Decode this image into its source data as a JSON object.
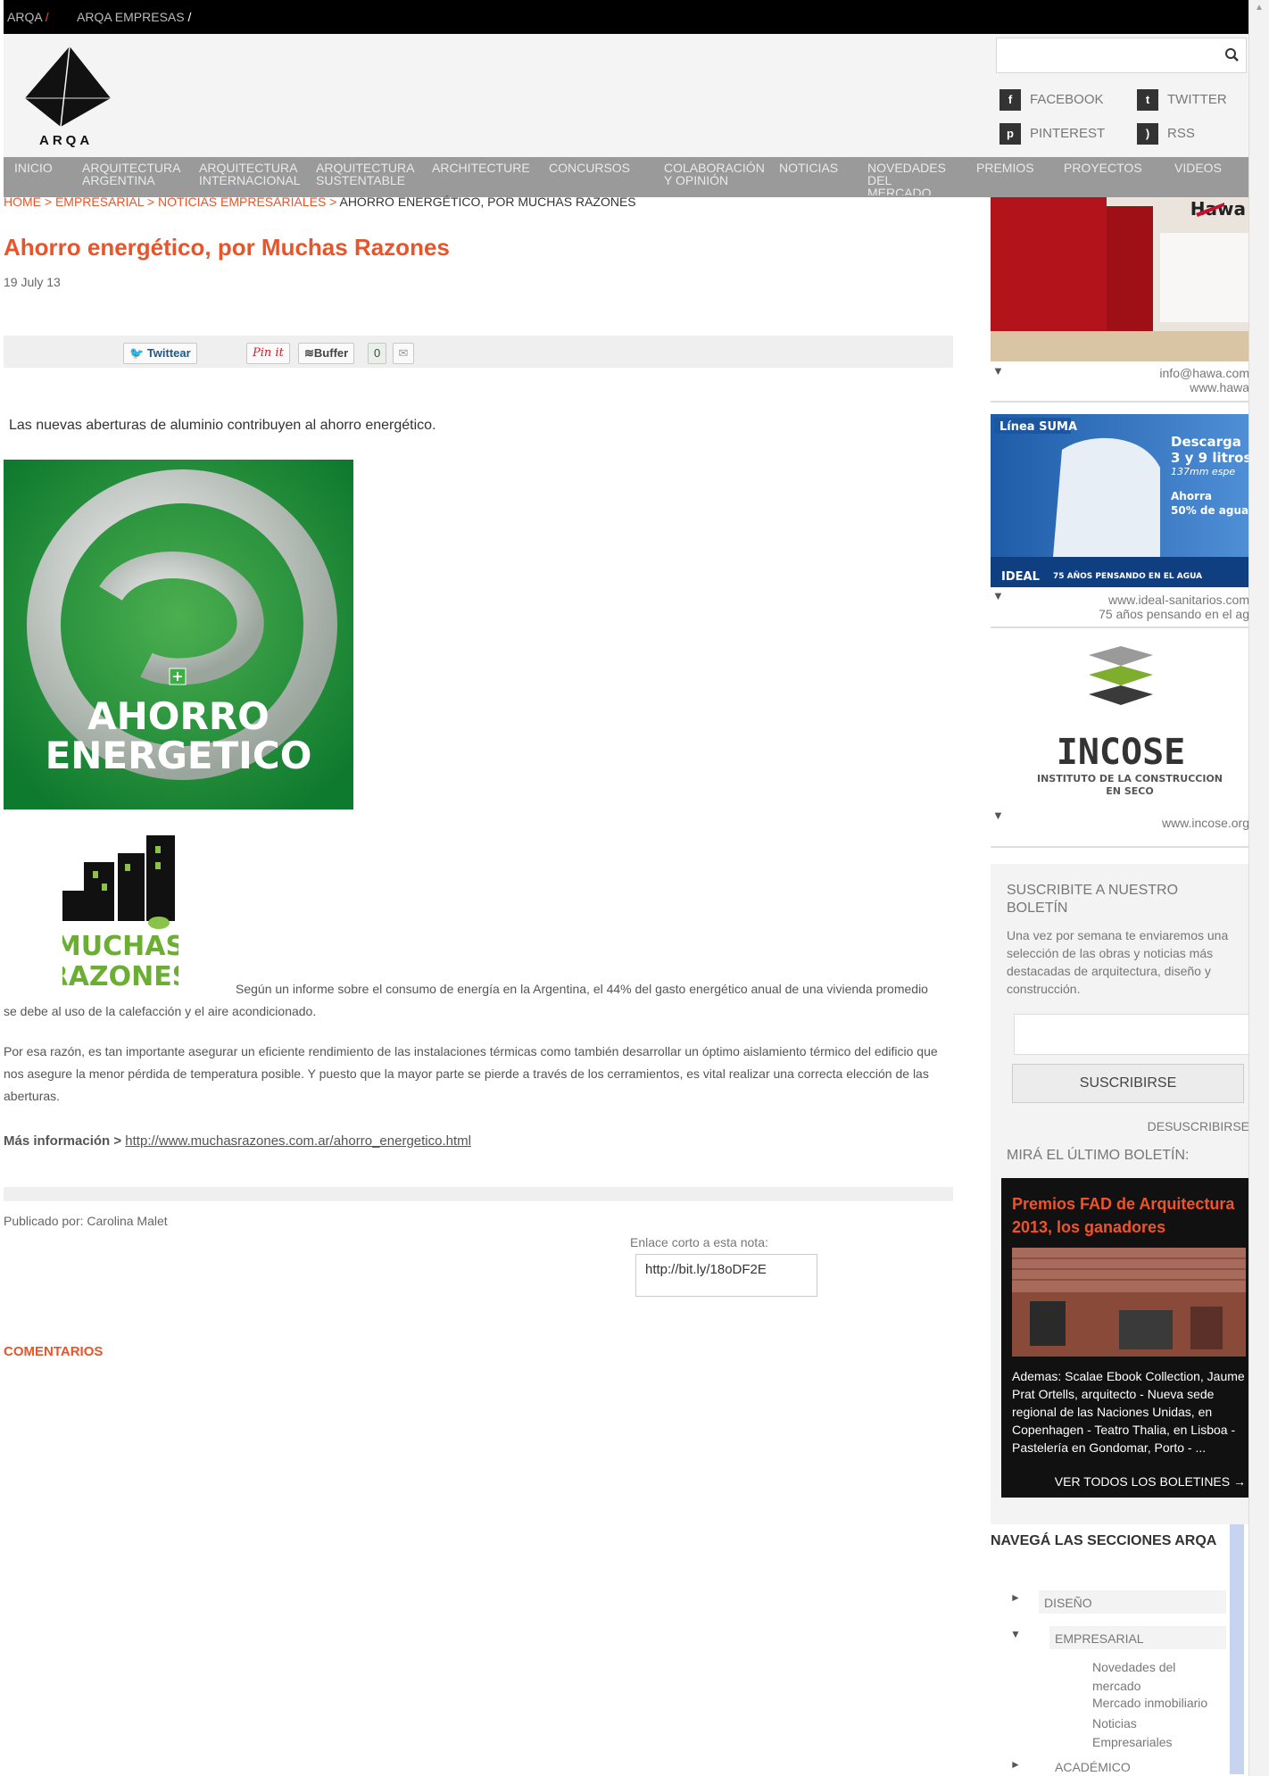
{
  "topbar": {
    "links": [
      "ARQA",
      "ARQA EMPRESAS"
    ]
  },
  "header": {
    "logo_text": "ARQA",
    "search": {
      "placeholder": "",
      "value": ""
    },
    "social": [
      "FACEBOOK",
      "TWITTER",
      "PINTEREST",
      "RSS"
    ]
  },
  "nav": {
    "items": [
      "INICIO",
      "ARQUITECTURA ARGENTINA",
      "ARQUITECTURA INTERNACIONAL",
      "ARQUITECTURA SUSTENTABLE",
      "ARCHITECTURE",
      "CONCURSOS",
      "COLABORACIÓN Y OPINIÓN",
      "NOTICIAS",
      "NOVEDADES DEL MERCADO",
      "PREMIOS",
      "PROYECTOS",
      "VIDEOS"
    ]
  },
  "breadcrumb": {
    "items": [
      "HOME",
      "EMPRESARIAL",
      "NOTICIAS EMPRESARIALES"
    ],
    "current": "AHORRO ENERGÉTICO, POR MUCHAS RAZONES",
    "separator": " > "
  },
  "article": {
    "title": "Ahorro energético, por Muchas Razones",
    "date": "19 July 13",
    "share": {
      "twitter": "Twittear",
      "pinterest": "Pin it",
      "buffer": "Buffer",
      "count": "0"
    },
    "intro": "Las nuevas aberturas de aluminio contribuyen al ahorro energético.",
    "image_text": [
      "AHORRO",
      "ENERGETICO"
    ],
    "logo_text": [
      "MUCHAS",
      "RAZONES"
    ],
    "paragraph1": "Según un informe sobre el consumo de energía en la Argentina, el 44% del gasto energético anual de una vivienda promedio se debe al uso de la calefacción y el aire acondicionado.",
    "paragraph2": "Por esa razón, es tan importante asegurar un eficiente rendimiento de las instalaciones térmicas como también desarrollar un óptimo aislamiento térmico del edificio que nos asegure la menor pérdida de temperatura posible. Y puesto que la mayor parte se pierde a través de los cerramientos, es vital realizar una correcta elección de las aberturas.",
    "more_label": "Más información >",
    "more_link": "http://www.muchasrazones.com.ar/ahorro_energetico.html",
    "author": "Publicado por: Carolina Malet",
    "short_label": "Enlace corto a esta nota:",
    "short_link": "http://bit.ly/18oDF2E",
    "comments_label": "COMENTARIOS"
  },
  "sidebar": {
    "ads": [
      {
        "brand": "Hawa",
        "lines": [
          "info@hawa.com",
          "www.hawa"
        ]
      },
      {
        "brand": "IDEAL",
        "lines": [
          "www.ideal-sanitarios.com",
          "75 años pensando en el ag"
        ],
        "banner_text": [
          "Línea SUMA",
          "Descarga",
          "3 y 9 litros",
          "137mm espe",
          "Ahorra",
          "50% de agua",
          "75 AÑOS PENSANDO EN EL AGUA"
        ]
      },
      {
        "brand": "INCOSE",
        "lines": [
          "www.incose.org"
        ],
        "banner_text": [
          "INSTITUTO DE LA CONSTRUCCION",
          "EN SECO"
        ]
      }
    ],
    "newsletter": {
      "title": "SUSCRIBITE A NUESTRO BOLETÍN",
      "description": "Una vez por semana te enviaremos una selección de las obras y noticias más destacadas de arquitectura, diseño y construcción.",
      "input_value": "",
      "button": "SUSCRIBIRSE",
      "unsubscribe": "DESUSCRIBIRSE",
      "latest_label": "MIRÁ EL ÚLTIMO BOLETÍN:",
      "latest_title": "Premios FAD de Arquitectura 2013, los ganadores",
      "latest_desc": "Ademas: Scalae Ebook Collection, Jaume Prat Ortells, arquitecto - Nueva sede regional de las Naciones Unidas, en Copenhagen - Teatro Thalia, en Lisboa - Pastelería en Gondomar, Porto - ...",
      "all_link": "VER TODOS LOS BOLETINES →"
    },
    "sections": {
      "title": "NAVEGÁ LAS SECCIONES ARQA",
      "items": [
        {
          "label": "DISEÑO",
          "expanded": false
        },
        {
          "label": "EMPRESARIAL",
          "expanded": true,
          "children": [
            "Novedades del mercado",
            "Mercado inmobiliario",
            "Noticias Empresariales"
          ]
        },
        {
          "label": "ACADÉMICO",
          "expanded": false
        }
      ]
    }
  },
  "colors": {
    "accent": "#e8552a",
    "nav": "#9a9a9a",
    "topbar": "#000000"
  },
  "icons": {
    "search": "search-icon",
    "facebook": "facebook-icon",
    "twitter": "twitter-icon",
    "pinterest": "pinterest-icon",
    "rss": "rss-icon",
    "email": "email-icon"
  }
}
